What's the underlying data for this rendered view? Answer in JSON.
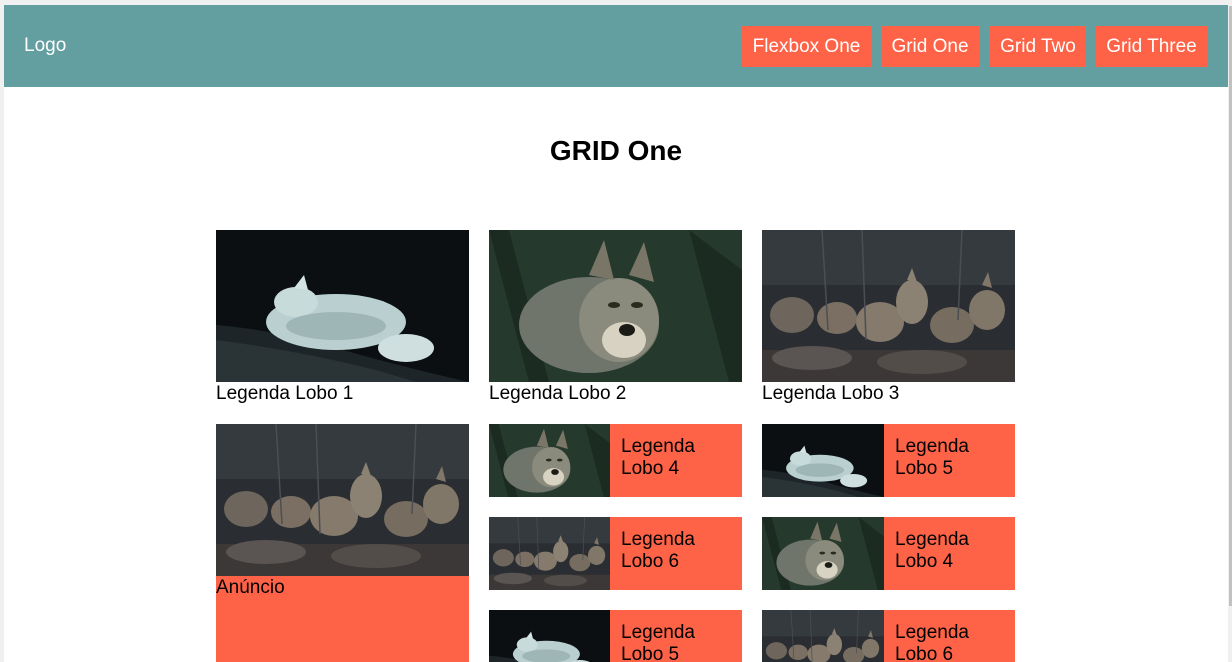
{
  "header": {
    "logo": "Logo",
    "nav": [
      {
        "label": "Flexbox One"
      },
      {
        "label": "Grid One"
      },
      {
        "label": "Grid Two"
      },
      {
        "label": "Grid Three"
      }
    ]
  },
  "main": {
    "title": "GRID One",
    "gallery": [
      {
        "caption": "Legenda Lobo 1"
      },
      {
        "caption": "Legenda Lobo 2"
      },
      {
        "caption": "Legenda Lobo 3"
      }
    ],
    "ad_label": "Anúncio",
    "tiles": [
      {
        "caption_line1": "Legenda",
        "caption_line2": "Lobo 4"
      },
      {
        "caption_line1": "Legenda",
        "caption_line2": "Lobo 5"
      },
      {
        "caption_line1": "Legenda",
        "caption_line2": "Lobo 6"
      },
      {
        "caption_line1": "Legenda",
        "caption_line2": "Lobo 4"
      },
      {
        "caption_line1": "Legenda",
        "caption_line2": "Lobo 5"
      },
      {
        "caption_line1": "Legenda",
        "caption_line2": "Lobo 6"
      }
    ]
  },
  "colors": {
    "header_bg": "#639ea0",
    "accent": "#ff6347"
  }
}
